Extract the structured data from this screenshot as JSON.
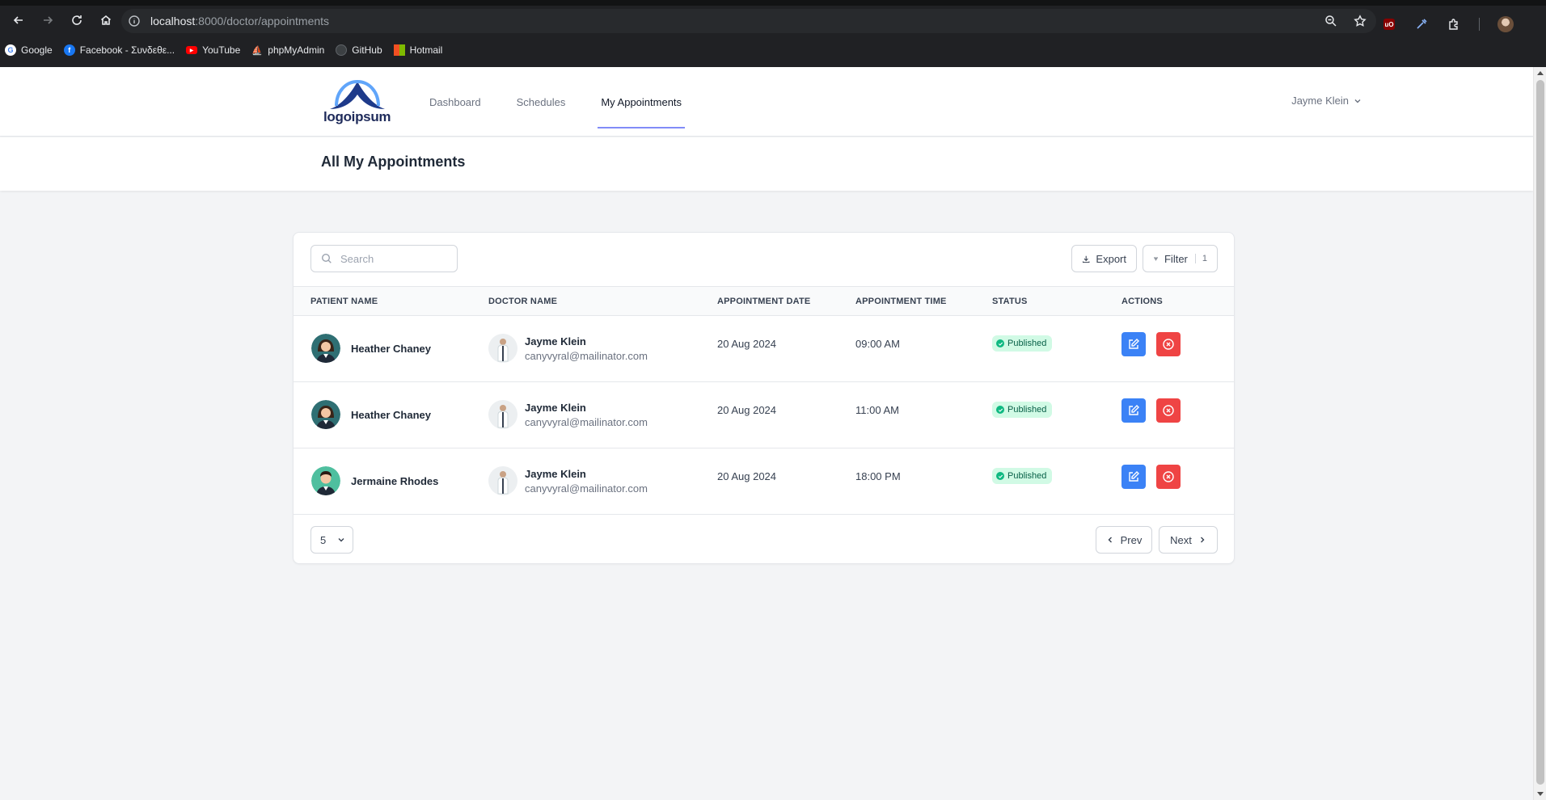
{
  "browser": {
    "url_host": "localhost",
    "url_path": ":8000/doctor/appointments",
    "bookmarks": [
      {
        "label": "Google",
        "color": "#ffffff"
      },
      {
        "label": "Facebook - Συνδεθε...",
        "color": "#1877f2"
      },
      {
        "label": "YouTube",
        "color": "#ff0000"
      },
      {
        "label": "phpMyAdmin",
        "color": "#f89c0e"
      },
      {
        "label": "GitHub",
        "color": "#202124"
      },
      {
        "label": "Hotmail",
        "color": "#f25022"
      }
    ]
  },
  "nav": {
    "logo_text": "logoipsum",
    "links": [
      {
        "label": "Dashboard",
        "active": false
      },
      {
        "label": "Schedules",
        "active": false
      },
      {
        "label": "My Appointments",
        "active": true
      }
    ],
    "user_name": "Jayme Klein"
  },
  "page": {
    "title": "All My Appointments"
  },
  "toolbar": {
    "search_placeholder": "Search",
    "export_label": "Export",
    "filter_label": "Filter",
    "filter_count": "1"
  },
  "table": {
    "columns": [
      "PATIENT NAME",
      "DOCTOR NAME",
      "APPOINTMENT DATE",
      "APPOINTMENT TIME",
      "STATUS",
      "ACTIONS"
    ],
    "rows": [
      {
        "patient": "Heather Chaney",
        "patient_avatar": "female",
        "doctor": "Jayme Klein",
        "doctor_email": "canyvyral@mailinator.com",
        "date": "20 Aug 2024",
        "time": "09:00 AM",
        "status": "Published"
      },
      {
        "patient": "Heather Chaney",
        "patient_avatar": "female",
        "doctor": "Jayme Klein",
        "doctor_email": "canyvyral@mailinator.com",
        "date": "20 Aug 2024",
        "time": "11:00 AM",
        "status": "Published"
      },
      {
        "patient": "Jermaine Rhodes",
        "patient_avatar": "male",
        "doctor": "Jayme Klein",
        "doctor_email": "canyvyral@mailinator.com",
        "date": "20 Aug 2024",
        "time": "18:00 PM",
        "status": "Published"
      }
    ]
  },
  "pagination": {
    "per_page": "5",
    "prev_label": "Prev",
    "next_label": "Next"
  },
  "colors": {
    "edit": "#3b82f6",
    "delete": "#ef4444",
    "status_bg": "#d1fae5",
    "status_text": "#065f46",
    "logo": "#1e2a5a"
  }
}
